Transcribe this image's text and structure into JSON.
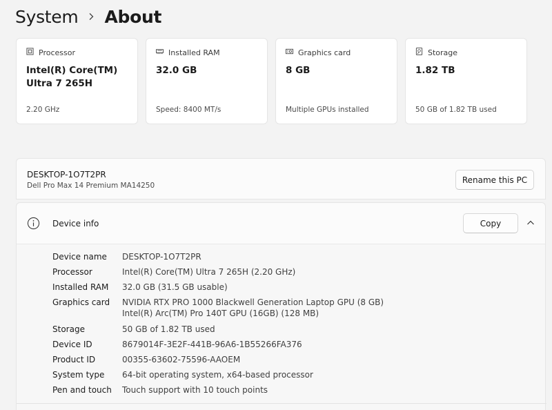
{
  "breadcrumb": {
    "parent": "System",
    "current": "About"
  },
  "cards": [
    {
      "icon": "processor-icon",
      "label": "Processor",
      "value": "Intel(R) Core(TM) Ultra 7 265H",
      "sub": "2.20 GHz"
    },
    {
      "icon": "ram-icon",
      "label": "Installed RAM",
      "value": "32.0 GB",
      "sub": "Speed: 8400 MT/s"
    },
    {
      "icon": "graphics-card-icon",
      "label": "Graphics card",
      "value": "8 GB",
      "sub": "Multiple GPUs installed"
    },
    {
      "icon": "storage-icon",
      "label": "Storage",
      "value": "1.82 TB",
      "sub": "50 GB of 1.82 TB used"
    }
  ],
  "pc": {
    "name": "DESKTOP-1O7T2PR",
    "model": "Dell Pro Max 14 Premium MA14250",
    "rename_label": "Rename this PC"
  },
  "device_info": {
    "title": "Device info",
    "copy_label": "Copy",
    "rows": [
      {
        "label": "Device name",
        "value": "DESKTOP-1O7T2PR"
      },
      {
        "label": "Processor",
        "value": "Intel(R) Core(TM) Ultra 7 265H (2.20 GHz)"
      },
      {
        "label": "Installed RAM",
        "value": "32.0 GB (31.5 GB usable)"
      },
      {
        "label": "Graphics card",
        "value": "NVIDIA RTX PRO 1000 Blackwell Generation Laptop GPU (8 GB)",
        "value2": "Intel(R) Arc(TM) Pro 140T GPU (16GB) (128 MB)"
      },
      {
        "label": "Storage",
        "value": "50 GB of 1.82 TB used"
      },
      {
        "label": "Device ID",
        "value": "8679014F-3E2F-441B-96A6-1B55266FA376"
      },
      {
        "label": "Product ID",
        "value": "00355-63602-75596-AAOEM"
      },
      {
        "label": "System type",
        "value": "64-bit operating system, x64-based processor"
      },
      {
        "label": "Pen and touch",
        "value": "Touch support with 10 touch points"
      }
    ]
  }
}
